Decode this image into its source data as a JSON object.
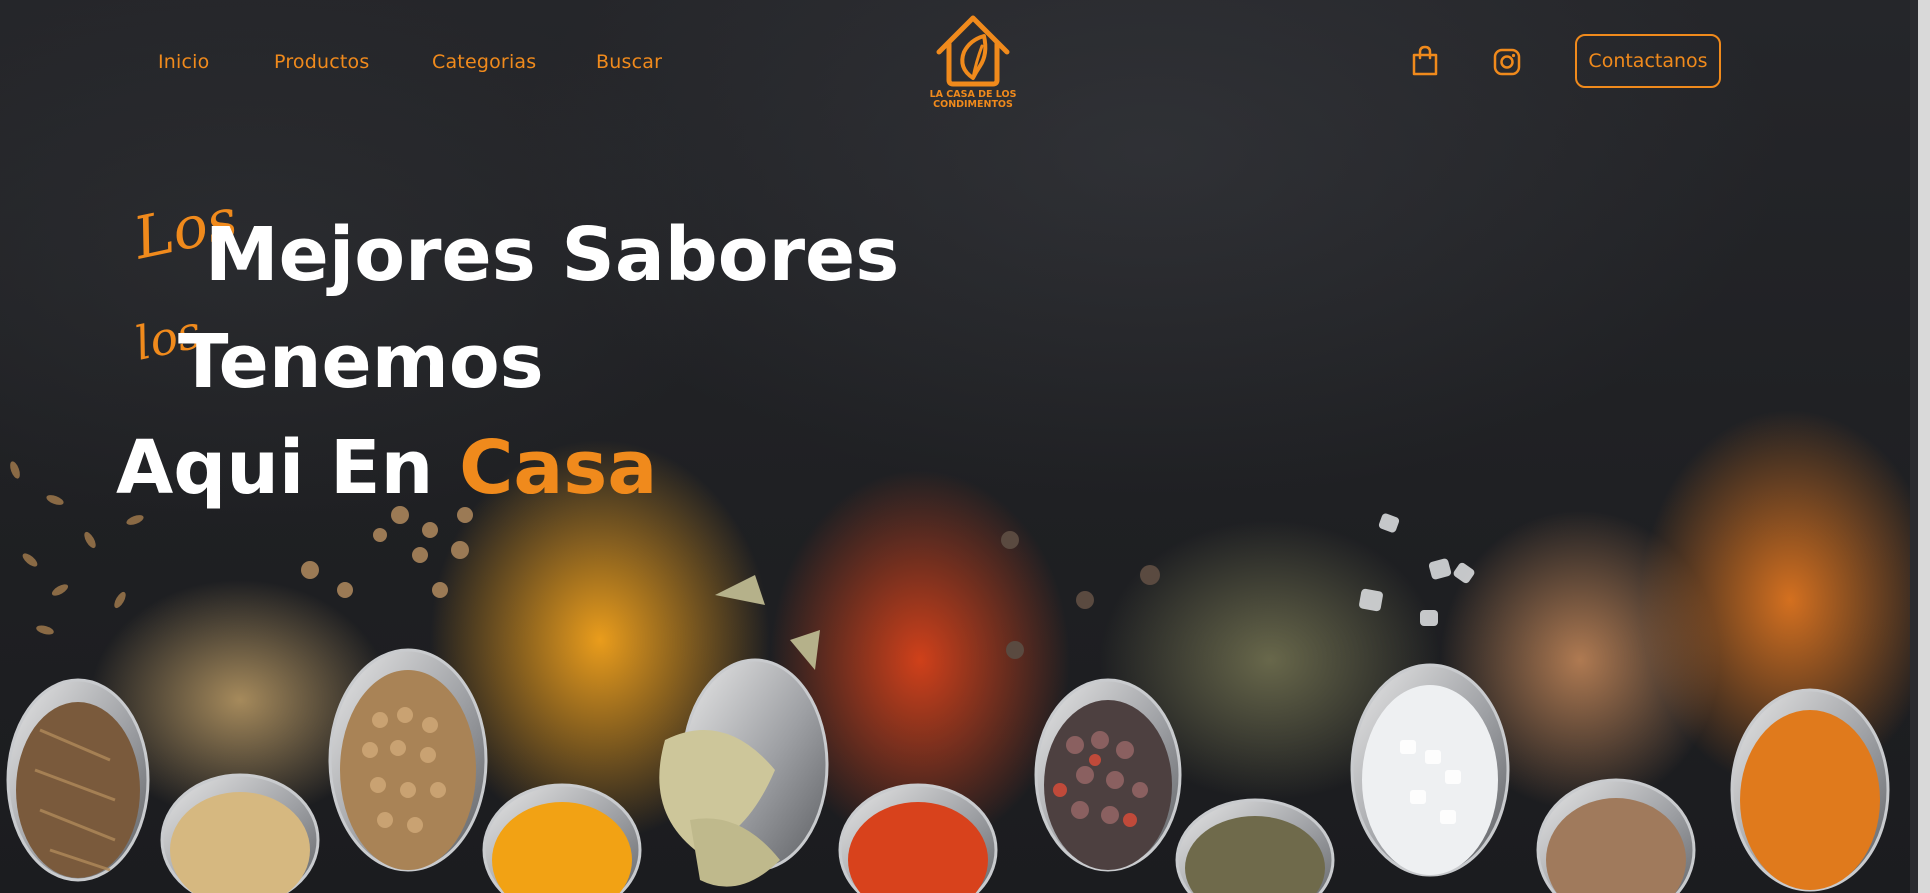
{
  "nav": {
    "links": [
      {
        "label": "Inicio"
      },
      {
        "label": "Productos"
      },
      {
        "label": "Categorias"
      },
      {
        "label": "Buscar"
      }
    ],
    "logo_text": "LA CASA DE LOS CONDIMENTOS",
    "cart_icon": "shopping-bag-icon",
    "instagram_icon": "instagram-icon",
    "contact_label": "Contactanos"
  },
  "hero": {
    "line1_script": "Los",
    "line1_text": "Mejores Sabores",
    "line2_script": "los",
    "line2_text": "Tenemos",
    "line3_text": "Aqui En",
    "line3_accent": "Casa"
  },
  "colors": {
    "accent": "#f08a1c",
    "background": "#202123",
    "headline": "#ffffff"
  }
}
